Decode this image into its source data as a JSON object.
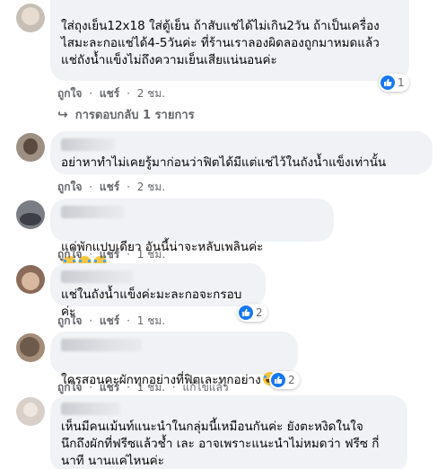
{
  "comments": [
    {
      "text": "ใส่ถุงเย็น12x18 ใส่ตู้เย็น ถ้าสับแช่ได้ไม่เกิน2วัน ถ้าเป็นเครื่อง\nไสมะละกอแช่ได้4-5วันค่ะ ที่ร้านเราลองผิดลองถูกมาหมดแล้ว\nแช่ถังน้ำแข็งไม่ถึงความเย็นเสียแน่นอนค่ะ",
      "like": "ถูกใจ",
      "sep": "·",
      "reply": "แชร์",
      "time": "2 ชม.",
      "reaction_count": "1",
      "replies_label": "การตอบกลับ 1 รายการ"
    },
    {
      "text": "อย่าหาทำไม่เคยรู้มาก่อนว่าฟิตได้มีแต่แช่ไว้ในถังน้ำแข็งเท่านั้น",
      "like": "ถูกใจ",
      "sep": "·",
      "reply": "แชร์",
      "time": "2 ชม."
    },
    {
      "text": "แค่พักแปบเดียว อันนี้น่าจะหลับเพลินค่ะ",
      "emoji": [
        "laughing-tears",
        "laughing-tears",
        "laughing-tears"
      ],
      "like": "ถูกใจ",
      "sep": "·",
      "reply": "แชร์",
      "time": "1 ชม."
    },
    {
      "text": "แช่ในถังน้ำแข็งค่ะมะละกอจะกรอบค่ะ",
      "like": "ถูกใจ",
      "sep": "·",
      "reply": "แชร์",
      "time": "1 ชม.",
      "reaction_count": "2"
    },
    {
      "text": "ใครสอนคะผักทุกอย่างที่ฟิตเละทุกอย่าง",
      "emoji": [
        "laughing-tears"
      ],
      "like": "ถูกใจ",
      "sep": "·",
      "reply": "แชร์",
      "time": "1 ชม.",
      "edited": "แก้ไขแล้ว",
      "reaction_count": "2"
    },
    {
      "text": "เห็นมีคนเม้นท์แนะนำในกลุ่มนี้เหมือนกันค่ะ ยังตะหงิดในใจ\nนึกถึงผักที่ฟรีซแล้วช้ำ เละ อาจเพราะแนะนำไม่หมดว่า ฟรีซ กี่\nนาที นานแค่ไหนค่ะ"
    }
  ],
  "colors": {
    "bubble": "#f0f2f5",
    "meta": "#65676b",
    "like_blue": "#1877f2"
  },
  "icons": [
    "thumbs-up-icon",
    "reply-arrow-icon",
    "laughing-tears-emoji"
  ]
}
